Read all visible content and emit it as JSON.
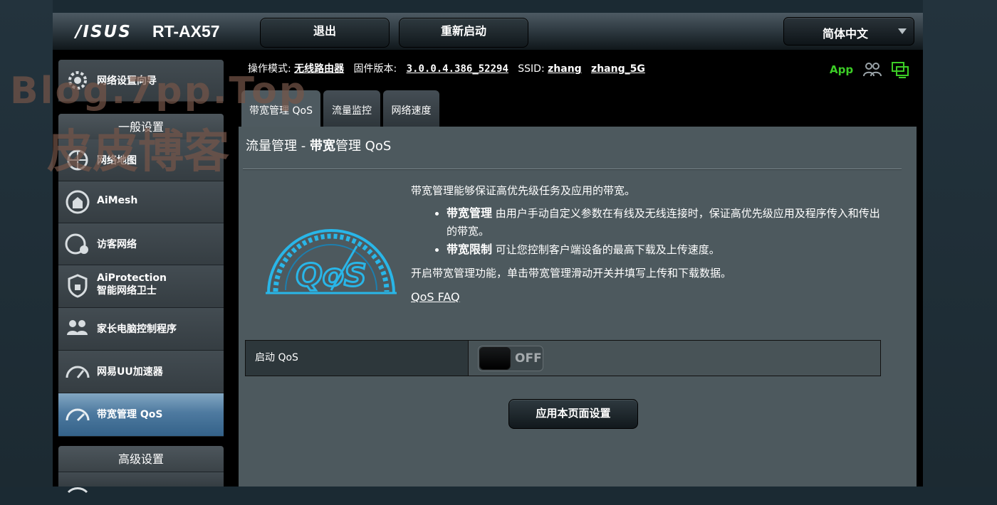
{
  "header": {
    "brand": "/ISUS",
    "model": "RT-AX57",
    "logout_label": "退出",
    "reboot_label": "重新启动",
    "language": "简体中文"
  },
  "infobar": {
    "mode_label": "操作模式:",
    "mode_value": "无线路由器",
    "firmware_label": "固件版本:",
    "firmware_value": "3.0.0.4.386_52294",
    "ssid_label": "SSID:",
    "ssid_1": "zhang",
    "ssid_2": "zhang_5G",
    "app_label": "App"
  },
  "sidebar": {
    "quick_setup": "网络设置向导",
    "general_header": "一般设置",
    "items": [
      {
        "label": "网络地图",
        "icon": "network-map-icon"
      },
      {
        "label": "AiMesh",
        "icon": "aimesh-icon"
      },
      {
        "label": "访客网络",
        "icon": "guest-network-icon"
      },
      {
        "label": "AiProtection",
        "label2": "智能网络卫士",
        "icon": "aiprotection-shield-icon"
      },
      {
        "label": "家长电脑控制程序",
        "icon": "parental-control-icon"
      },
      {
        "label": "网易UU加速器",
        "icon": "uu-booster-gauge-icon"
      },
      {
        "label": "带宽管理 QoS",
        "icon": "qos-gauge-icon",
        "active": true
      }
    ],
    "advanced_header": "高级设置"
  },
  "tabs": [
    {
      "label": "带宽管理 QoS",
      "active": true
    },
    {
      "label": "流量监控"
    },
    {
      "label": "网络速度"
    }
  ],
  "panel": {
    "title_part1": "流量管理 - ",
    "title_part2": "带宽",
    "title_part3": "管理 QoS",
    "intro": "带宽管理能够保证高优先级任务及应用的带宽。",
    "bullet1_strong": "带宽管理",
    "bullet1_text": " 由用户手动自定义参数在有线及无线连接时，保证高优先级应用及程序传入和传出的带宽。",
    "bullet2_strong": "带宽限制",
    "bullet2_text": " 可让您控制客户端设备的最高下载及上传速度。",
    "instruction": "开启带宽管理功能，单击带宽管理滑动开关并填写上传和下载数据。",
    "faq_link": "QoS FAQ",
    "enable_label": "启动 QoS",
    "toggle_state": "OFF",
    "apply_label": "应用本页面设置",
    "logo_text": "QoS"
  },
  "colors": {
    "accent_cyan": "#29b6e8",
    "app_green": "#3ccd26",
    "active_tab_blue": "#4e7aa0"
  },
  "watermark": {
    "line1": "Blog.7pp.Top",
    "line2": "皮皮博客"
  }
}
